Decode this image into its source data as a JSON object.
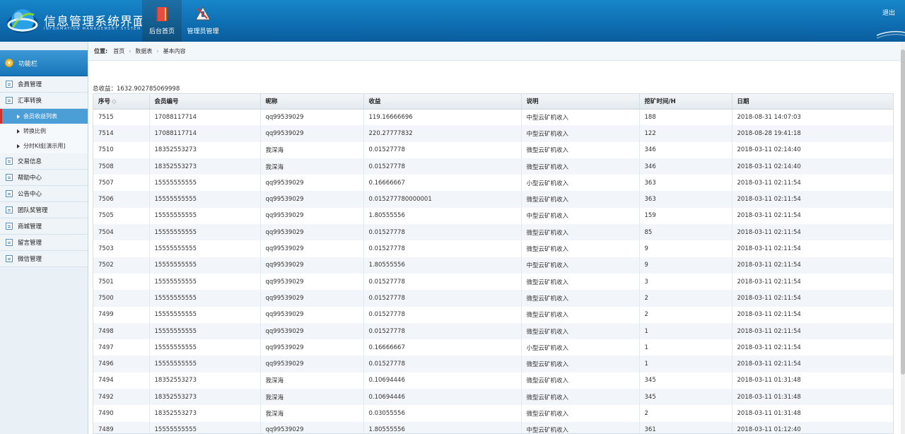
{
  "header": {
    "title": "信息管理系统界面",
    "subtitle": "INFORMATION MANAGEMENT SYSTEM GUI",
    "nav": [
      {
        "label": "后台首页",
        "icon": "book-icon"
      },
      {
        "label": "管理员管理",
        "icon": "admin-tools-icon"
      }
    ],
    "logout": "退出",
    "colors": {
      "header_bg": "#0f6fb3",
      "active_nav": "#1d6fa6"
    }
  },
  "sidebar": {
    "heading": "功能栏",
    "items": [
      {
        "label": "会員管理"
      },
      {
        "label": "汇率转换"
      }
    ],
    "sub_items": [
      {
        "label": "会员收益列表"
      },
      {
        "label": "转换比例"
      },
      {
        "label": "分时K线[演示用]"
      }
    ],
    "more_items": [
      {
        "label": "交易信息"
      },
      {
        "label": "帮助中心"
      },
      {
        "label": "公告中心"
      },
      {
        "label": "团队奖管理"
      },
      {
        "label": "商城管理"
      },
      {
        "label": "留言管理"
      },
      {
        "label": "微信管理"
      }
    ]
  },
  "breadcrumb": {
    "label": "位置:",
    "items": [
      "首页",
      "数据表",
      "基本内容"
    ]
  },
  "total": "总收益：1632.902785069998",
  "table": {
    "columns": [
      "序号",
      "会员编号",
      "昵称",
      "收益",
      "说明",
      "挖矿时间/H",
      "日期"
    ],
    "sort_marker": "◇",
    "rows": [
      [
        "7515",
        "17088117714",
        "qq99539029",
        "119.16666696",
        "中型云矿机收入",
        "188",
        "2018-08-31 14:07:03"
      ],
      [
        "7514",
        "17088117714",
        "qq99539029",
        "220.27777832",
        "中型云矿机收入",
        "122",
        "2018-08-28 19:41:18"
      ],
      [
        "7510",
        "18352553273",
        "我深海",
        "0.01527778",
        "微型云矿机收入",
        "346",
        "2018-03-11 02:14:40"
      ],
      [
        "7508",
        "18352553273",
        "我深海",
        "0.01527778",
        "微型云矿机收入",
        "346",
        "2018-03-11 02:14:40"
      ],
      [
        "7507",
        "15555555555",
        "qq99539029",
        "0.16666667",
        "小型云矿机收入",
        "363",
        "2018-03-11 02:11:54"
      ],
      [
        "7506",
        "15555555555",
        "qq99539029",
        "0.015277780000001",
        "微型云矿机收入",
        "363",
        "2018-03-11 02:11:54"
      ],
      [
        "7505",
        "15555555555",
        "qq99539029",
        "1.80555556",
        "中型云矿机收入",
        "159",
        "2018-03-11 02:11:54"
      ],
      [
        "7504",
        "15555555555",
        "qq99539029",
        "0.01527778",
        "微型云矿机收入",
        "85",
        "2018-03-11 02:11:54"
      ],
      [
        "7503",
        "15555555555",
        "qq99539029",
        "0.01527778",
        "微型云矿机收入",
        "9",
        "2018-03-11 02:11:54"
      ],
      [
        "7502",
        "15555555555",
        "qq99539029",
        "1.80555556",
        "中型云矿机收入",
        "9",
        "2018-03-11 02:11:54"
      ],
      [
        "7501",
        "15555555555",
        "qq99539029",
        "0.01527778",
        "微型云矿机收入",
        "3",
        "2018-03-11 02:11:54"
      ],
      [
        "7500",
        "15555555555",
        "qq99539029",
        "0.01527778",
        "微型云矿机收入",
        "2",
        "2018-03-11 02:11:54"
      ],
      [
        "7499",
        "15555555555",
        "qq99539029",
        "0.01527778",
        "微型云矿机收入",
        "2",
        "2018-03-11 02:11:54"
      ],
      [
        "7498",
        "15555555555",
        "qq99539029",
        "0.01527778",
        "微型云矿机收入",
        "1",
        "2018-03-11 02:11:54"
      ],
      [
        "7497",
        "15555555555",
        "qq99539029",
        "0.16666667",
        "小型云矿机收入",
        "1",
        "2018-03-11 02:11:54"
      ],
      [
        "7496",
        "15555555555",
        "qq99539029",
        "0.01527778",
        "微型云矿机收入",
        "1",
        "2018-03-11 02:11:54"
      ],
      [
        "7494",
        "18352553273",
        "我深海",
        "0.10694446",
        "微型云矿机收入",
        "345",
        "2018-03-11 01:31:48"
      ],
      [
        "7492",
        "18352553273",
        "我深海",
        "0.10694446",
        "微型云矿机收入",
        "345",
        "2018-03-11 01:31:48"
      ],
      [
        "7490",
        "18352553273",
        "我深海",
        "0.03055556",
        "微型云矿机收入",
        "2",
        "2018-03-11 01:31:48"
      ],
      [
        "7489",
        "15555555555",
        "qq99539029",
        "1.80555556",
        "中型云矿机收入",
        "361",
        "2018-03-11 01:12:40"
      ]
    ]
  }
}
